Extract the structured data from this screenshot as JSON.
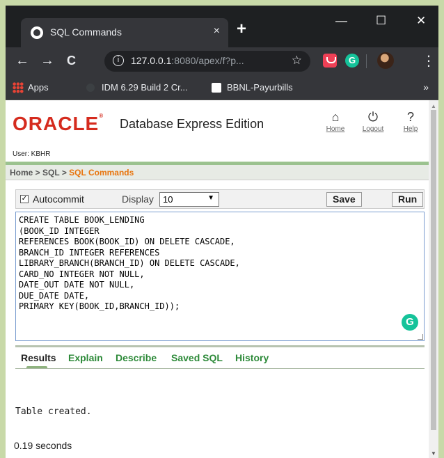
{
  "browser": {
    "tab_title": "SQL Commands",
    "tab_close": "×",
    "new_tab": "+",
    "window_controls": {
      "minimize": "—",
      "maximize": "☐",
      "close": "✕"
    },
    "nav": {
      "back": "←",
      "forward": "→",
      "reload": "C"
    },
    "url": {
      "host": "127.0.0.1",
      "rest": ":8080/apex/f?p..."
    },
    "info_icon": "i",
    "star": "☆",
    "grammarly_ext": "G",
    "menu": "⋮",
    "bookmarks": [
      {
        "label": "Apps"
      },
      {
        "label": "IDM 6.29 Build 2 Cr..."
      },
      {
        "label": "BBNL-Payurbills"
      }
    ],
    "bookmarks_more": "»"
  },
  "apex": {
    "logo": "ORACLE",
    "logo_mark": "®",
    "product": "Database Express Edition",
    "header_links": [
      {
        "label": "Home",
        "glyph": "⌂"
      },
      {
        "label": "Logout",
        "glyph": "⏻"
      },
      {
        "label": "Help",
        "glyph": "?"
      }
    ],
    "user": "User: KBHR",
    "breadcrumb": {
      "home": "Home",
      "sep1": " > ",
      "sql": "SQL",
      "sep2": " > ",
      "current": "SQL Commands"
    },
    "controls": {
      "autocommit_checked": true,
      "autocommit_label": "Autocommit",
      "display_label": "Display",
      "display_value": "10",
      "save": "Save",
      "run": "Run"
    },
    "sql_text": "CREATE TABLE BOOK_LENDING\n(BOOK_ID INTEGER\nREFERENCES BOOK(BOOK_ID) ON DELETE CASCADE,\nBRANCH_ID INTEGER REFERENCES\nLIBRARY_BRANCH(BRANCH_ID) ON DELETE CASCADE,\nCARD_NO INTEGER NOT NULL,\nDATE_OUT DATE NOT NULL,\nDUE_DATE DATE,\nPRIMARY KEY(BOOK_ID,BRANCH_ID));",
    "grammarly": "G",
    "result_tabs": [
      "Results",
      "Explain",
      "Describe",
      "Saved SQL",
      "History"
    ],
    "output": "Table created.",
    "timing": "0.19 seconds"
  }
}
